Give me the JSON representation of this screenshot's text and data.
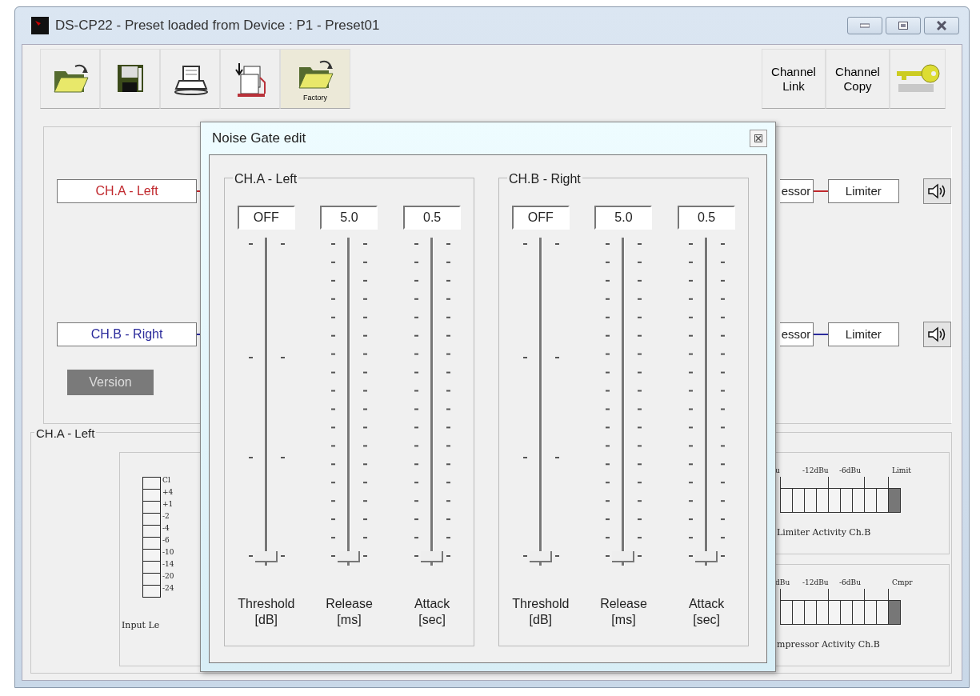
{
  "window": {
    "title": "DS-CP22 - Preset loaded from Device : P1 - Preset01"
  },
  "toolbar": {
    "buttons": [
      {
        "kind": "open"
      },
      {
        "kind": "save"
      },
      {
        "kind": "print"
      },
      {
        "kind": "transfer"
      },
      {
        "kind": "factory",
        "label": "Factory"
      }
    ],
    "channel_buttons": [
      {
        "label": "Channel Link"
      },
      {
        "label": "Channel Copy"
      }
    ]
  },
  "routing": [
    {
      "channel": "CH.A - Left",
      "color": "#c0282d",
      "block_cut": "essor",
      "block": "Limiter"
    },
    {
      "channel": "CH.B - Right",
      "color": "#2b2b9c",
      "block_cut": "essor",
      "block": "Limiter"
    }
  ],
  "version_button": "Version",
  "meter_group": {
    "title": "CH.A - Left",
    "input_meter": {
      "scale": [
        "Cl",
        "+4",
        "+1",
        "-2",
        "-4",
        "-6",
        "-10",
        "-14",
        "-20",
        "-24"
      ],
      "caption": "Input Le"
    },
    "activity_meters": [
      {
        "scale": [
          "u",
          "-12dBu",
          "-6dBu",
          "Limit"
        ],
        "caption": "Limiter Activity Ch.B"
      },
      {
        "scale": [
          "dBu",
          "-12dBu",
          "-6dBu",
          "Cmpr"
        ],
        "caption": "mpressor Activity Ch.B"
      }
    ]
  },
  "dialog": {
    "title": "Noise Gate edit",
    "channels": [
      {
        "title": "CH.A - Left",
        "sliders": [
          {
            "value": "OFF",
            "label": "Threshold",
            "unit": "[dB]",
            "kind": "coarse",
            "level": 0
          },
          {
            "value": "5.0",
            "label": "Release",
            "unit": "[ms]",
            "kind": "fine",
            "level": 0
          },
          {
            "value": "0.5",
            "label": "Attack",
            "unit": "[sec]",
            "kind": "fine",
            "level": 0
          }
        ]
      },
      {
        "title": "CH.B - Right",
        "sliders": [
          {
            "value": "OFF",
            "label": "Threshold",
            "unit": "[dB]",
            "kind": "coarse",
            "level": 0
          },
          {
            "value": "5.0",
            "label": "Release",
            "unit": "[ms]",
            "kind": "fine",
            "level": 0
          },
          {
            "value": "0.5",
            "label": "Attack",
            "unit": "[sec]",
            "kind": "fine",
            "level": 0
          }
        ]
      }
    ]
  }
}
